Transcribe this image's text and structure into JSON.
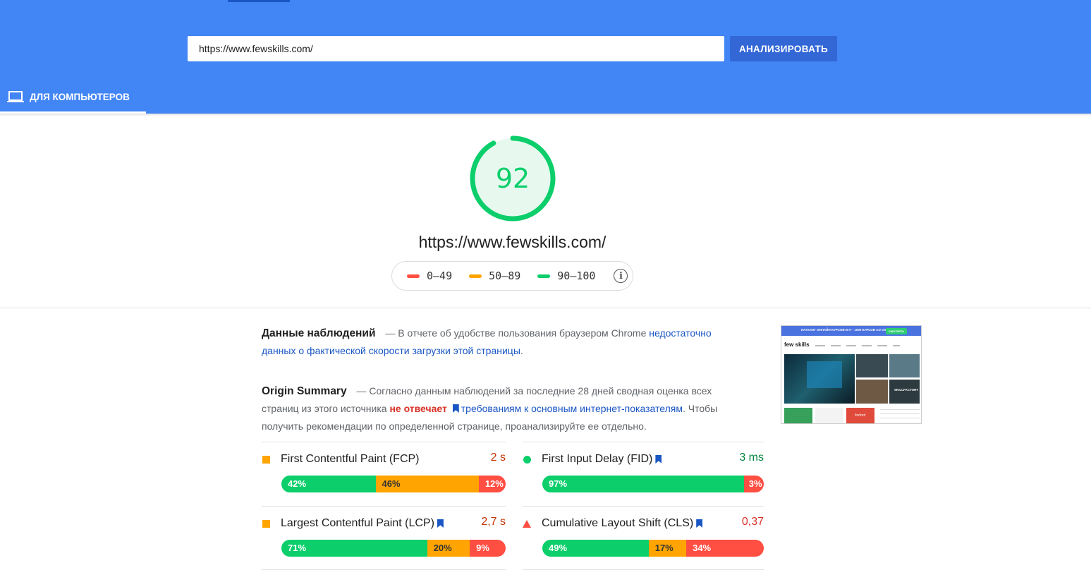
{
  "header": {
    "url_value": "https://www.fewskills.com/",
    "analyze_label": "АНАЛИЗИРОВАТЬ",
    "tab_desktop_label": "ДЛЯ КОМПЬЮТЕРОВ",
    "tab_icon": "laptop-icon",
    "bg_color": "#4285f4"
  },
  "score": {
    "value": "92",
    "fraction": 0.92,
    "color": "#0cce6b",
    "url": "https://www.fewskills.com/"
  },
  "legend": {
    "items": [
      {
        "label": "0–49",
        "color": "#ff4e42"
      },
      {
        "label": "50–89",
        "color": "#ffa400"
      },
      {
        "label": "90–100",
        "color": "#0cce6b"
      }
    ],
    "info_icon": "info-icon"
  },
  "field_data": {
    "title": "Данные наблюдений",
    "text": " — В отчете об удобстве пользования браузером Chrome ",
    "link": "недостаточно данных о фактической скорости загрузки этой страницы",
    "end": "."
  },
  "origin_summary": {
    "title": "Origin Summary",
    "text1": " — Согласно данным наблюдений за последние 28 дней сводная оценка всех страниц из этого источника ",
    "bad": "не отвечает",
    "link": "требованиям к основным интернет-показателям",
    "text2": ". Чтобы получить рекомендации по определенной странице, проанализируйте ее отдельно."
  },
  "metrics": [
    {
      "name": "First Contentful Paint (FCP)",
      "value": "2 s",
      "status": "average",
      "bookmark": false,
      "distribution": [
        {
          "label": "42%",
          "pct": 42
        },
        {
          "label": "46%",
          "pct": 46
        },
        {
          "label": "12%",
          "pct": 12
        }
      ]
    },
    {
      "name": "First Input Delay (FID)",
      "value": "3 ms",
      "status": "good",
      "bookmark": true,
      "distribution": [
        {
          "label": "97%",
          "pct": 97
        },
        {
          "label": "",
          "pct": 0
        },
        {
          "label": "3%",
          "pct": 3
        }
      ]
    },
    {
      "name": "Largest Contentful Paint (LCP)",
      "value": "2,7 s",
      "status": "average",
      "bookmark": true,
      "distribution": [
        {
          "label": "71%",
          "pct": 71
        },
        {
          "label": "20%",
          "pct": 20
        },
        {
          "label": "9%",
          "pct": 9
        }
      ]
    },
    {
      "name": "Cumulative Layout Shift (CLS)",
      "value": "0,37",
      "status": "poor",
      "bookmark": true,
      "distribution": [
        {
          "label": "49%",
          "pct": 49
        },
        {
          "label": "17%",
          "pct": 17
        },
        {
          "label": "34%",
          "pct": 34
        }
      ]
    }
  ],
  "thumbnail": {
    "banner": "КАТАЛОГ ОНЛАЙН-КУРСОВ В IT - 1000 КУРСОВ СО СКИДКАМИ",
    "banner_btn": "СМОТРЕТЬ",
    "logo": "few skills",
    "badge": "SKILLFACTORY",
    "brand": "foxford"
  },
  "colors": {
    "good": "#0cce6b",
    "average": "#ffa400",
    "poor": "#ff4e42",
    "link": "#1a56c4"
  }
}
